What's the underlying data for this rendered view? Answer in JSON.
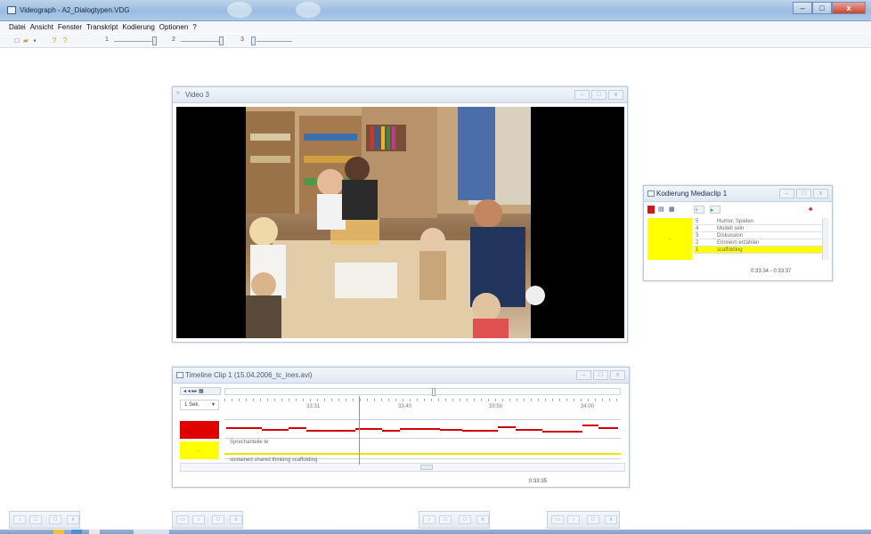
{
  "app": {
    "title": "Videograph - A2_Dialogtypen.VDG",
    "window_buttons": {
      "minimize": "–",
      "maximize": "□",
      "close": "x"
    }
  },
  "menu": [
    "Datei",
    "Ansicht",
    "Fenster",
    "Transkript",
    "Kodierung",
    "Optionen",
    "?"
  ],
  "toolbar": {
    "sliders": [
      {
        "label": "1"
      },
      {
        "label": "2"
      },
      {
        "label": "3"
      }
    ]
  },
  "video_window": {
    "title": "Video 3"
  },
  "kodierung_window": {
    "title": "Kodierung Mediaclip 1",
    "active_color": "#ffff00",
    "swatch_label": "..",
    "items": [
      {
        "num": "5",
        "label": "Humor, Spielen"
      },
      {
        "num": "4",
        "label": "Modell sein"
      },
      {
        "num": "3",
        "label": "Diskussion"
      },
      {
        "num": "2",
        "label": "Erinnern erzählen"
      },
      {
        "num": "1",
        "label": "scaffolding"
      }
    ],
    "selected_index": 4,
    "time_range": "0:33:34 - 0:33:37"
  },
  "timeline_window": {
    "title": "Timeline Clip 1 (15.04.2006_tc_ines.avi)",
    "unit": "1 Sek.",
    "ticks": [
      "33:31",
      "33:40",
      "33:50",
      "34:00"
    ],
    "tracks": [
      {
        "color": "#e00000",
        "swatch_label": "..",
        "label": "Sprechanteile te"
      },
      {
        "color": "#ffff00",
        "swatch_label": "...",
        "label": "sustained shared thinking scaffolding"
      }
    ],
    "current_time": "0:33:35"
  },
  "colors": {
    "title_blue": "#9bbbe0",
    "code_red": "#e00000",
    "code_yellow": "#ffff00"
  }
}
